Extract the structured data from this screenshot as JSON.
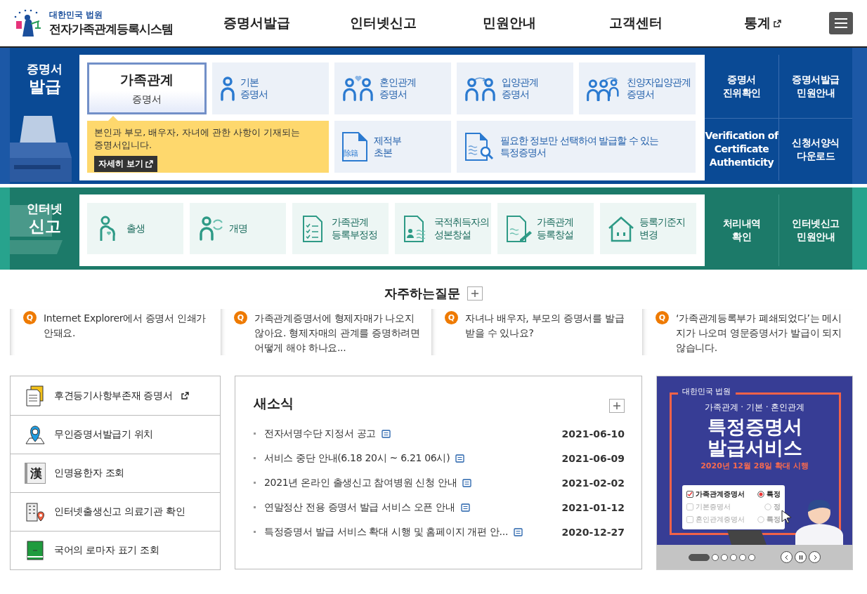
{
  "header": {
    "org": "대한민국 법원",
    "system": "전자가족관계등록시스템",
    "nav": [
      {
        "label": "증명서발급",
        "external": false
      },
      {
        "label": "인터넷신고",
        "external": false
      },
      {
        "label": "민원안내",
        "external": false
      },
      {
        "label": "고객센터",
        "external": false
      },
      {
        "label": "통계",
        "external": true
      }
    ]
  },
  "issue": {
    "heading": "증명서\n발급",
    "tiles": [
      {
        "label": "가족관계\n증명서",
        "selected": true
      },
      {
        "label": "기본\n증명서",
        "selected": false
      },
      {
        "label": "혼인관계\n증명서",
        "selected": false
      },
      {
        "label": "입양관계\n증명서",
        "selected": false
      },
      {
        "label": "친양자입양관계\n증명서",
        "selected": false
      },
      {
        "label": "제적부\n초본",
        "icon_text": "除籍",
        "selected": false
      },
      {
        "label": "필요한 정보만 선택하여 발급할 수 있는\n특정증명서",
        "selected": false
      }
    ],
    "tooltip": {
      "text": "본인과 부모, 배우자, 자녀에 관한 사항이 기재되는\n증명서입니다.",
      "button": "자세히 보기"
    },
    "side_links": [
      "증명서\n진위확인",
      "증명서발급\n민원안내",
      "Verification of\nCertificate\nAuthenticity",
      "신청서양식\n다운로드"
    ]
  },
  "report": {
    "heading": "인터넷\n신고",
    "tiles": [
      "출생",
      "개명",
      "가족관계\n등록부정정",
      "국적취득자의\n성본창설",
      "가족관계\n등록창설",
      "등록기준지\n변경"
    ],
    "side_links": [
      "처리내역\n확인",
      "인터넷신고\n민원안내"
    ]
  },
  "faq": {
    "title": "자주하는질문",
    "items": [
      {
        "badge": "Q",
        "text": "Internet Explorer에서 증명서 인쇄가 안돼요."
      },
      {
        "badge": "Q",
        "text": "가족관계증명서에 형제자매가 나오지 않아요. 형제자매의 관계를 증명하려면 어떻게 해야 하나요..."
      },
      {
        "badge": "Q",
        "text": "자녀나 배우자, 부모의 증명서를 발급 받을 수 있나요?"
      },
      {
        "badge": "Q",
        "text": "‘가족관계등록부가 폐쇄되었다’는 메시지가 나오며 영문증명서가 발급이 되지 않습니다."
      }
    ]
  },
  "quick_links": [
    {
      "label": "후견등기사항부존재 증명서",
      "external": true
    },
    {
      "label": "무인증명서발급기 위치",
      "external": false
    },
    {
      "label": "인명용한자 조회",
      "icon_text": "漢",
      "external": false
    },
    {
      "label": "인터넷출생신고 의료기관 확인",
      "external": false
    },
    {
      "label": "국어의 로마자 표기 조회",
      "external": false
    }
  ],
  "news": {
    "title": "새소식",
    "items": [
      {
        "title": "전자서명수단 지정서 공고",
        "date": "2021-06-10"
      },
      {
        "title": "서비스 중단 안내(6.18 20시 ~ 6.21 06시)",
        "date": "2021-06-09"
      },
      {
        "title": "2021년 온라인 출생신고 참여병원 신청 안내",
        "date": "2021-02-02"
      },
      {
        "title": "연말정산 전용 증명서 발급 서비스 오픈 안내",
        "date": "2021-01-12"
      },
      {
        "title": "특정증명서 발급 서비스 확대 시행 및 홈페이지 개편 안...",
        "date": "2020-12-27"
      }
    ]
  },
  "banner": {
    "org": "대한민국 법원",
    "subtitle": "가족관계 · 기본 · 혼인관계",
    "title": "특정증명서\n발급서비스",
    "date": "2020년 12월 28일 확대 시행",
    "options": [
      {
        "label": "가족관계증명서",
        "checked": true,
        "choice": "특정",
        "selected": true
      },
      {
        "label": "기본증명서",
        "checked": false,
        "choice": "정",
        "selected": false
      },
      {
        "label": "혼인관계증명서",
        "checked": false,
        "choice": "특정",
        "selected": false
      }
    ],
    "slides": [
      {
        "selected": true
      },
      {
        "selected": false
      },
      {
        "selected": false
      },
      {
        "selected": false
      },
      {
        "selected": false
      },
      {
        "selected": false
      }
    ]
  }
}
